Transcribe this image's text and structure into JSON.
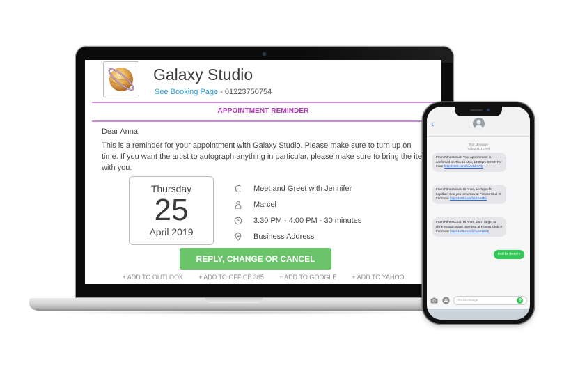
{
  "email": {
    "studio_name": "Galaxy Studio",
    "booking_link": "See Booking Page",
    "separator": " - ",
    "phone": "01223750754",
    "section_title": "APPOINTMENT REMINDER",
    "greeting": "Dear Anna,",
    "body": "This is a reminder for your appointment with Galaxy Studio. Please make sure to turn up on time. If you want the artist to autograph anything in particular, please make sure to bring the item with you.",
    "date": {
      "weekday": "Thursday",
      "day": "25",
      "month_year": "April 2019"
    },
    "details": [
      {
        "icon": "service-icon",
        "text": "Meet and Greet with Jennifer"
      },
      {
        "icon": "person-icon",
        "text": "Marcel"
      },
      {
        "icon": "clock-icon",
        "text": "3:30 PM - 4:00 PM - 30 minutes"
      },
      {
        "icon": "location-pin-icon",
        "text": "Business Address"
      }
    ],
    "cta_label": "REPLY, CHANGE OR CANCEL",
    "calendar_links": [
      "+ ADD TO OUTLOOK",
      "+ ADD TO OFFICE 365",
      "+ ADD TO GOOGLE",
      "+ ADD TO YAHOO"
    ],
    "colors": {
      "accent_purple": "#b03ab6",
      "rule_purple": "#c98ad6",
      "link_blue": "#2a9fd6",
      "cta_green": "#6cc46a"
    }
  },
  "phone": {
    "meta_line1": "Text Message",
    "meta_line2": "Today 11:16 AM",
    "messages": [
      {
        "pre": "From FitnessClub: Your appointment is confirmed on Thu 16 May, 12:30pm CEST. For more ",
        "link": "http://10t8.com/b/vk4dr8AQ"
      },
      {
        "pre": "From FitnessClub: Hi Anne, Let's get fit together. See you tomorrow at Fitness Club !!! For more ",
        "link": "http://10t8.com/b/drKe2Es"
      },
      {
        "pre": "From FitnessClub: Hi Anne, Don't forget to drink enough water. See you at Fitness Club !!! For more ",
        "link": "http://10t8.com/b/hus016Cb"
      }
    ],
    "reply": "I will be there !!!",
    "input_placeholder": "Text Message",
    "colors": {
      "sent_bubble": "#34c759",
      "received_bubble": "#e5e5ea",
      "ios_blue": "#3478f6"
    }
  }
}
